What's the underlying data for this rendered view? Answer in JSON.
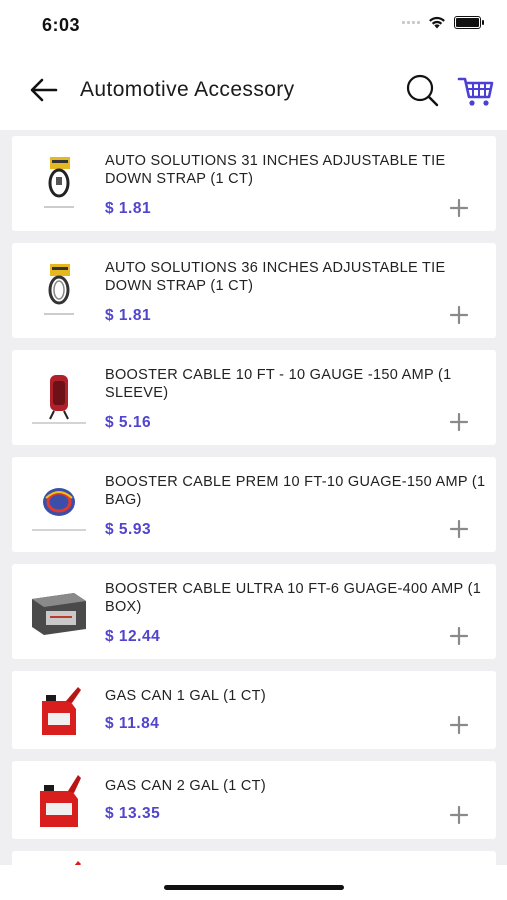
{
  "status_bar": {
    "time": "6:03"
  },
  "header": {
    "title": "Automotive Accessory"
  },
  "products": [
    {
      "name": "AUTO SOLUTIONS 31 INCHES ADJUSTABLE TIE DOWN STRAP (1 CT)",
      "price": "$ 1.81"
    },
    {
      "name": "AUTO SOLUTIONS 36 INCHES ADJUSTABLE TIE DOWN STRAP (1 CT)",
      "price": "$ 1.81"
    },
    {
      "name": "BOOSTER CABLE 10 FT - 10 GAUGE -150 AMP (1 SLEEVE)",
      "price": "$ 5.16"
    },
    {
      "name": "BOOSTER CABLE PREM 10 FT-10 GUAGE-150 AMP (1 BAG)",
      "price": "$ 5.93"
    },
    {
      "name": "BOOSTER CABLE ULTRA 10 FT-6 GUAGE-400 AMP (1 BOX)",
      "price": "$ 12.44"
    },
    {
      "name": "GAS CAN 1 GAL (1 CT)",
      "price": "$ 11.84"
    },
    {
      "name": "GAS CAN 2 GAL (1 CT)",
      "price": "$ 13.35"
    }
  ],
  "colors": {
    "price": "#5145cd",
    "cart_icon": "#4c3fd6",
    "list_background": "#efeff1"
  },
  "icons": {
    "back": "arrow-left-icon",
    "search": "search-icon",
    "cart": "cart-icon",
    "add": "plus-icon"
  }
}
